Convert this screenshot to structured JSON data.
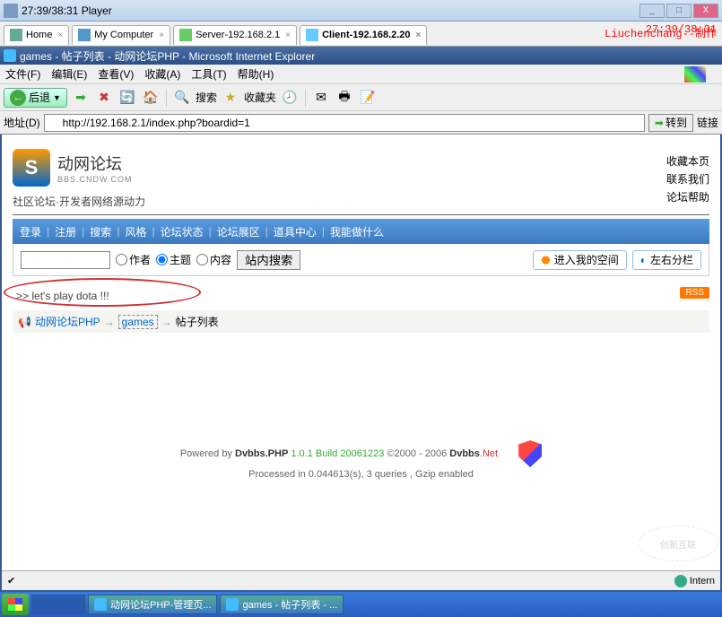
{
  "player": {
    "title": "27:39/38:31 Player",
    "timestamp_overlay": "27:39/38:31",
    "author_overlay": "Liuchenchang--制作"
  },
  "win_controls": {
    "min": "_",
    "max": "□",
    "close": "X"
  },
  "tabs": [
    {
      "label": "Home",
      "active": false
    },
    {
      "label": "My Computer",
      "active": false
    },
    {
      "label": "Server-192.168.2.1",
      "active": false
    },
    {
      "label": "Client-192.168.2.20",
      "active": true
    }
  ],
  "ie": {
    "title": "games - 帖子列表 - 动网论坛PHP - Microsoft Internet Explorer",
    "menus": [
      "文件(F)",
      "编辑(E)",
      "查看(V)",
      "收藏(A)",
      "工具(T)",
      "帮助(H)"
    ],
    "back": "后退",
    "search": "搜索",
    "favorites": "收藏夹",
    "addr_label": "地址(D)",
    "url": "http://192.168.2.1/index.php?boardid=1",
    "go": "转到",
    "links": "链接"
  },
  "forum": {
    "logo_zh": "动网论坛",
    "logo_en": "BBS.CNDW.COM",
    "slogan": "社区论坛·开发者网络源动力",
    "side_links": [
      "收藏本页",
      "联系我们",
      "论坛帮助"
    ],
    "nav": [
      "登录",
      "注册",
      "搜索",
      "风格",
      "论坛状态",
      "论坛展区",
      "道具中心",
      "我能做什么"
    ],
    "radio_author": "作者",
    "radio_topic": "主题",
    "radio_content": "内容",
    "search_btn": "站内搜索",
    "space_btn": "进入我的空间",
    "split_btn": "左右分栏",
    "notice": ">> let's play dota !!!",
    "rss": "RSS",
    "bc_root": "动网论坛PHP",
    "bc_board": "games",
    "bc_leaf": "帖子列表",
    "footer1_pre": "Powered by ",
    "footer1_prod": "Dvbbs.PHP",
    "footer1_ver": " 1.0.1 Build 20061223 ",
    "footer1_copy": "©2000 - 2006 ",
    "footer1_site": "Dvbbs",
    "footer1_net": ".Net",
    "footer2": "Processed in 0.044613(s), 3 queries , Gzip enabled"
  },
  "status": {
    "internet": "Intern"
  },
  "taskbar": {
    "items": [
      "动网论坛PHP-管理页...",
      "games - 帖子列表 - ..."
    ]
  },
  "watermark": "创新互联"
}
